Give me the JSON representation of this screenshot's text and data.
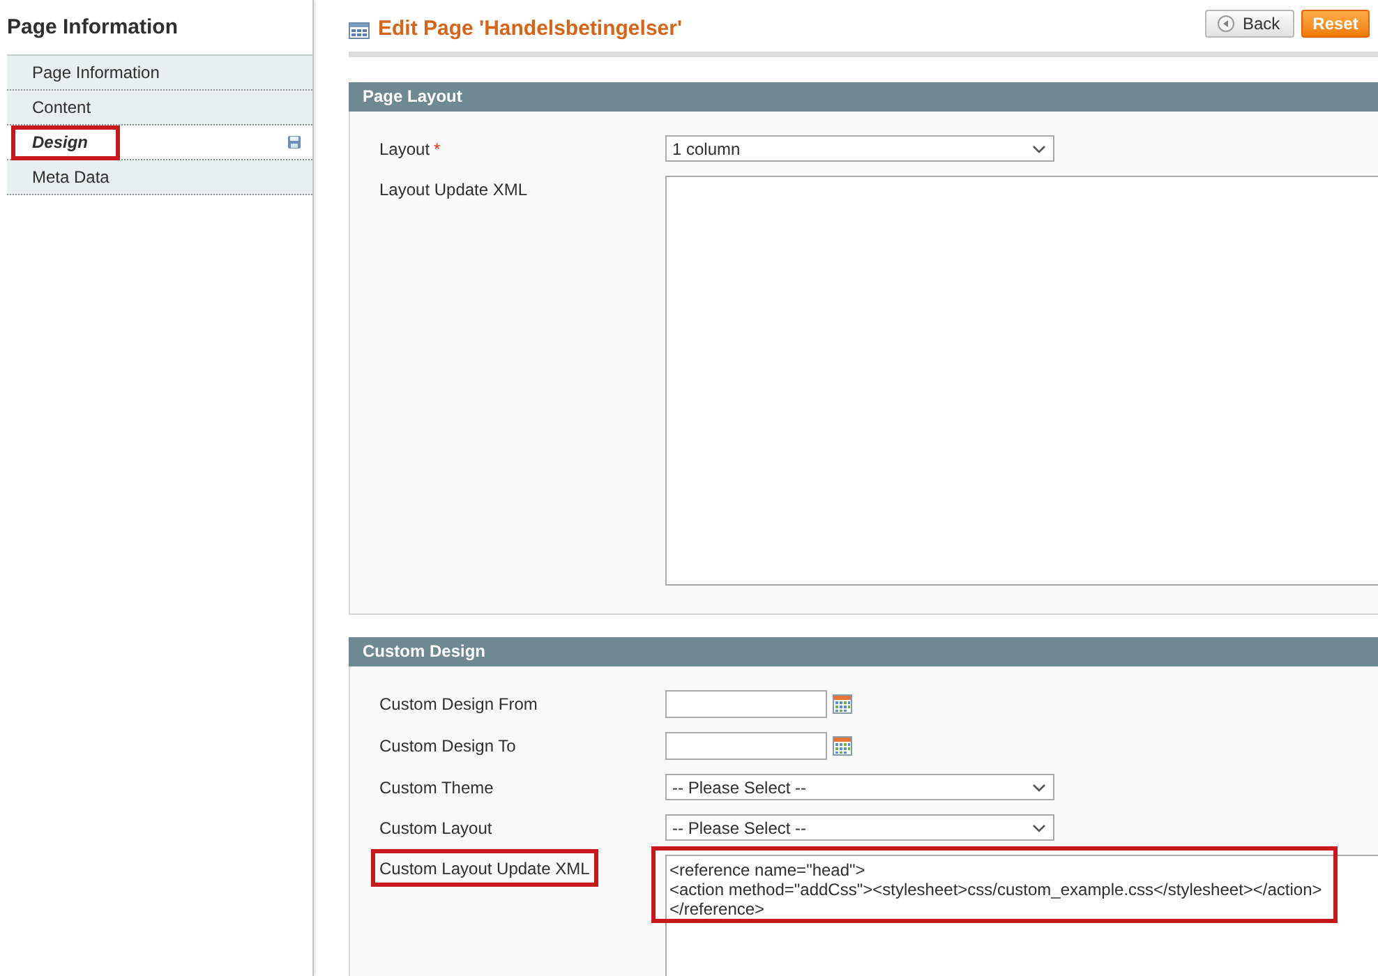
{
  "sidebar": {
    "title": "Page Information",
    "tabs": [
      {
        "label": "Page Information",
        "selected": false,
        "changed": false,
        "highlighted": false
      },
      {
        "label": "Content",
        "selected": false,
        "changed": false,
        "highlighted": false
      },
      {
        "label": "Design",
        "selected": true,
        "changed": true,
        "highlighted": true
      },
      {
        "label": "Meta Data",
        "selected": false,
        "changed": false,
        "highlighted": false
      }
    ]
  },
  "header": {
    "title": "Edit Page 'Handelsbetingelser'",
    "buttons": [
      {
        "label": "Back",
        "kind": "back"
      },
      {
        "label": "Reset",
        "kind": "reset"
      }
    ]
  },
  "sections": [
    {
      "title": "Page Layout",
      "fields": [
        {
          "label": "Layout",
          "required_mark": "*",
          "kind": "select",
          "value": "1 column",
          "highlighted": false
        },
        {
          "label": "Layout Update XML",
          "kind": "textarea",
          "highlighted": false
        }
      ]
    },
    {
      "title": "Custom Design",
      "fields": [
        {
          "label": "Custom Design From",
          "kind": "date",
          "highlighted": false
        },
        {
          "label": "Custom Design To",
          "kind": "date",
          "highlighted": false
        },
        {
          "label": "Custom Theme",
          "kind": "select",
          "value": "-- Please Select --",
          "highlighted": false
        },
        {
          "label": "Custom Layout",
          "kind": "select",
          "value": "-- Please Select --",
          "highlighted": false
        },
        {
          "label": "Custom Layout Update XML",
          "kind": "textarea",
          "value": "<reference name=\"head\">\n<action method=\"addCss\"><stylesheet>css/custom_example.css</stylesheet></action>\n</reference>",
          "highlighted": true
        }
      ]
    }
  ]
}
